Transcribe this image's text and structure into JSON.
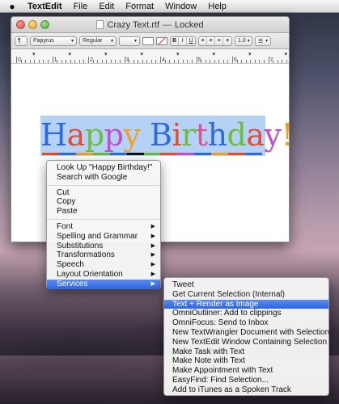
{
  "menubar": {
    "apple_icon": "apple-icon",
    "items": [
      "TextEdit",
      "File",
      "Edit",
      "Format",
      "Window",
      "Help"
    ]
  },
  "window": {
    "title": "Crazy Text.rtf",
    "separator": "—",
    "state": "Locked"
  },
  "toolbar": {
    "paragraph_style": "¶",
    "font_family": "Papyrus",
    "font_style": "Regular",
    "font_size": "",
    "bold": "B",
    "italic": "I",
    "underline": "U",
    "line_spacing": "1.0",
    "list": "☰"
  },
  "ruler": {
    "numbers": [
      "0",
      "1",
      "2",
      "3",
      "4",
      "5",
      "6",
      "7"
    ]
  },
  "document": {
    "text": "Happy Birthday!",
    "letter_colors": [
      "#2f6bd8",
      "#e44c2c",
      "#6bbd3a",
      "#c050c8",
      "#f0a020",
      "#2f6bd8",
      "#e44c2c",
      "#6bbd3a",
      "#e05090",
      "#2f6bd8",
      "#6bbd3a",
      "#e44c2c",
      "#c050c8",
      "#f0a020",
      "#e44c2c"
    ],
    "underline_colors": [
      "#e44c2c",
      "#2f6bd8",
      "#f0a020",
      "#6bbd3a",
      "#2f6bd8",
      "#111111",
      "#6bbd3a",
      "#e44c2c",
      "#c050c8",
      "#2f6bd8",
      "#f0a020",
      "#e44c2c",
      "#2f6bd8"
    ]
  },
  "context_menu": {
    "lookup": "Look Up \"Happy Birthday!\"",
    "search": "Search with Google",
    "cut": "Cut",
    "copy": "Copy",
    "paste": "Paste",
    "font": "Font",
    "spelling": "Spelling and Grammar",
    "substitutions": "Substitutions",
    "transformations": "Transformations",
    "speech": "Speech",
    "layout": "Layout Orientation",
    "services": "Services",
    "submenu_arrow": "▶"
  },
  "services_menu": {
    "items": [
      "Tweet",
      "Get Current Selection (Internal)",
      "Text + Render as Image",
      "OmniOutliner: Add to clippings",
      "OmniFocus: Send to Inbox",
      "New TextWrangler Document with Selection",
      "New TextEdit Window Containing Selection",
      "Make Task with Text",
      "Make Note with Text",
      "Make Appointment with Text",
      "EasyFind: Find Selection...",
      "Add to iTunes as a Spoken Track"
    ],
    "highlighted_index": 2
  }
}
